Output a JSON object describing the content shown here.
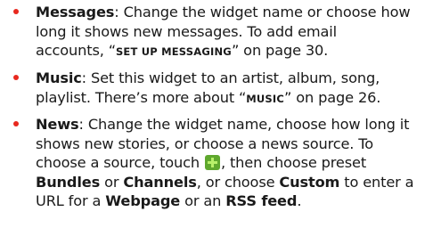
{
  "items": [
    {
      "term": "Messages",
      "line1_rest": ": Change the widget name or choose how",
      "line2": "long it shows new messages. To add email",
      "line3_pre": "accounts, “",
      "ref": "Set up messaging",
      "line3_post": "” on page 30."
    },
    {
      "term": "Music",
      "line1_rest": ": Set this widget to an artist, album, song,",
      "line2_pre": "playlist. There’s more about “",
      "ref": "Music",
      "line2_post": "” on page 26."
    },
    {
      "term": "News",
      "line1_rest": ": Change the widget name, choose how long it",
      "line2": "shows new stories, or choose a news source. To",
      "line3_pre": "choose a source, touch ",
      "line3_mid": ", then choose preset",
      "bundles": "Bundles",
      "or1": " or ",
      "channels": "Channels",
      "or2": ", or choose ",
      "custom": "Custom",
      "line4_post": " to enter a",
      "line5_pre": "URL for a ",
      "webpage": "Webpage",
      "or3": " or an ",
      "rss": "RSS feed",
      "period": "."
    }
  ],
  "colors": {
    "bullet": "#e8281e",
    "text": "#1a1a1a",
    "plus_icon_bg": "#5fa82e",
    "plus_icon_fg": "#b8f06a"
  },
  "icons": {
    "add": "plus-icon"
  }
}
